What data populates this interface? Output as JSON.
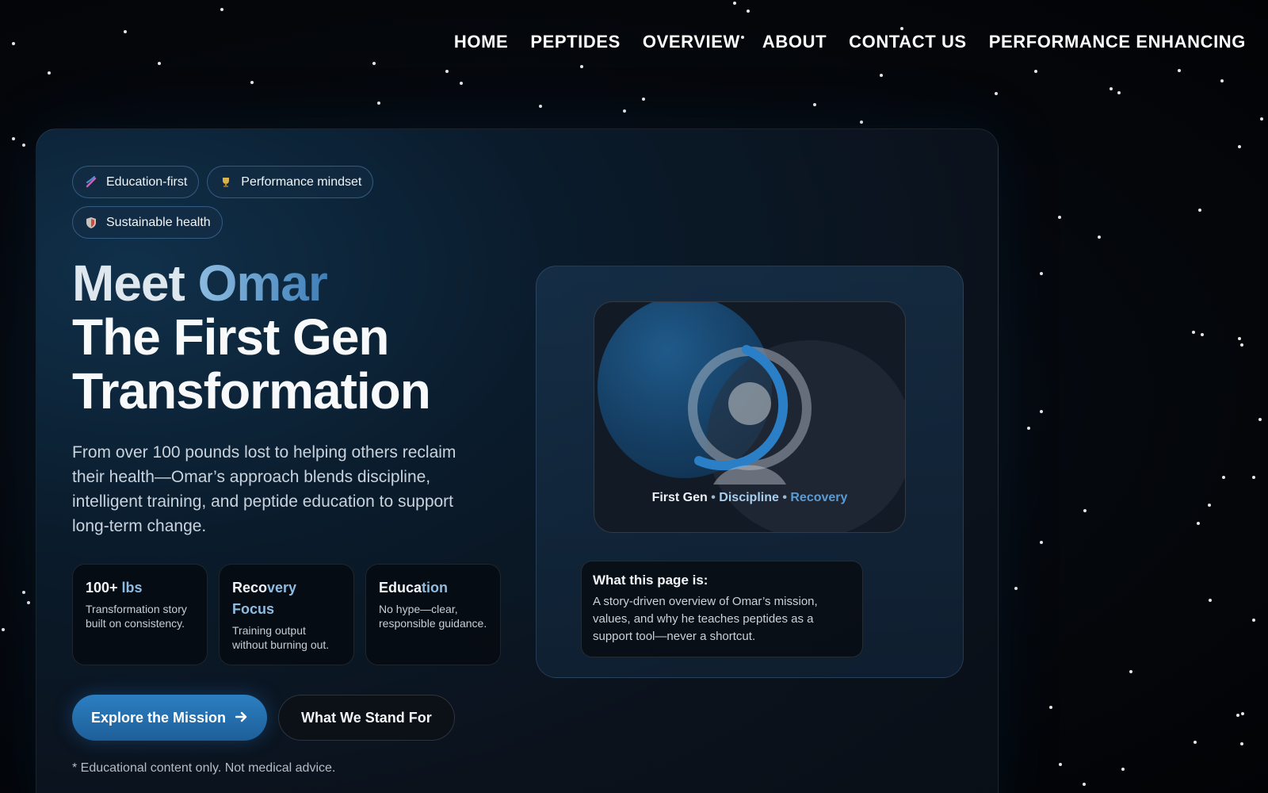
{
  "nav": {
    "items": [
      "HOME",
      "PEPTIDES",
      "OVERVIEW",
      "ABOUT",
      "CONTACT US",
      "PERFORMANCE ENHANCING"
    ]
  },
  "hero": {
    "pills": [
      {
        "label": "Education-first",
        "icon": "dna-icon"
      },
      {
        "label": "Performance mindset",
        "icon": "trophy-icon"
      },
      {
        "label": "Sustainable health",
        "icon": "shield-icon"
      }
    ],
    "title": {
      "meet": "Meet",
      "name": "Omar",
      "line2": "The First Gen",
      "line3": "Transformation"
    },
    "description": "From over 100 pounds lost to helping others reclaim their health—Omar’s approach blends discipline, intelligent training, and peptide education to support long-term change.",
    "stats": [
      {
        "title_main": "100+ ",
        "title_accent": "lbs",
        "text": "Transformation story built on consistency."
      },
      {
        "title_main": "Reco",
        "title_accent": "very Focus",
        "text": "Training output without burning out."
      },
      {
        "title_main": "Educa",
        "title_accent": "tion",
        "text": "No hype—clear, responsible guidance."
      }
    ],
    "primary_button": "Explore the Mission",
    "secondary_button": "What We Stand For",
    "disclaimer": "* Educational content only. Not medical advice."
  },
  "panel": {
    "caption": {
      "part1": "First Gen",
      "sep": " • ",
      "part2": "Discipline",
      "part3": "Recovery"
    },
    "info_title": "What this page is:",
    "info_text": "A story-driven overview of Omar’s mission, values, and why he teaches peptides as a support tool—never a shortcut."
  },
  "colors": {
    "accent": "#2c7fc2",
    "accent_light": "#8fbde2",
    "background": "#030508"
  }
}
